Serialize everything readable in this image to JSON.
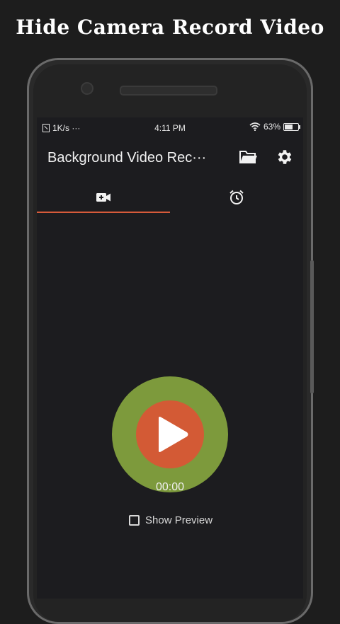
{
  "promo": {
    "title": "Hide Camera Record Video"
  },
  "status_bar": {
    "network_speed": "1K/s ···",
    "time": "4:11 PM",
    "battery": "63%",
    "battery_level": 0.63
  },
  "app_bar": {
    "title": "Background Video Rec···",
    "folder_icon": "folder-icon",
    "settings_icon": "gear-icon"
  },
  "tabs": [
    {
      "icon": "video-camera-icon",
      "selected": true
    },
    {
      "icon": "alarm-clock-icon",
      "selected": false
    }
  ],
  "recorder": {
    "timer": "00:00",
    "show_preview_label": "Show Preview",
    "show_preview_checked": false
  },
  "colors": {
    "accent": "#d65a3a",
    "record_outer": "#7d9a3c",
    "record_inner": "#d35a35",
    "screen_bg": "#1c1c1f"
  }
}
